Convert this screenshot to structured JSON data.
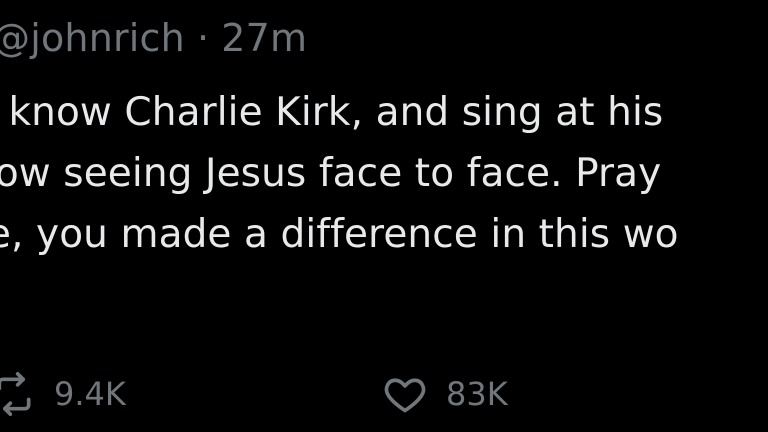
{
  "tweet": {
    "handle": "@johnrich",
    "separator": "·",
    "time": "27m",
    "lines": [
      "o know Charlie Kirk, and sing at his",
      "now seeing Jesus face to face. Pray",
      "ie, you made a difference in this wo"
    ]
  },
  "actions": {
    "repost": {
      "icon": "repost-icon",
      "count": "9.4K"
    },
    "like": {
      "icon": "heart-icon",
      "count": "83K"
    }
  },
  "colors": {
    "background": "#000000",
    "text": "#e7e9ea",
    "secondary": "#71767b"
  }
}
